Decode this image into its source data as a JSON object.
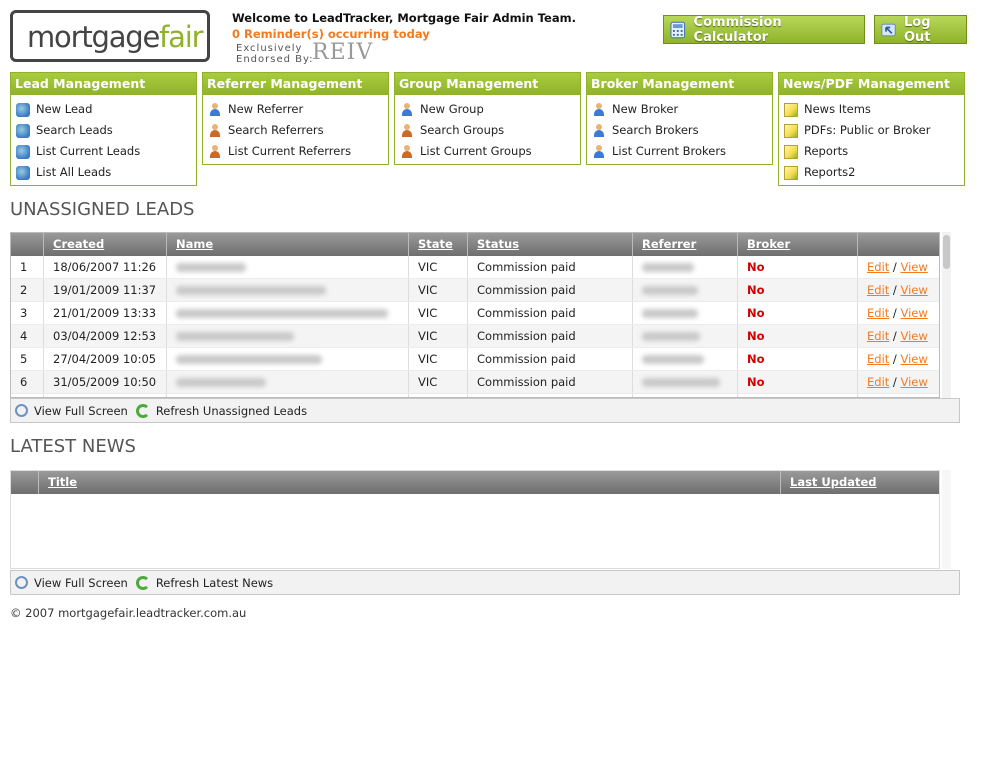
{
  "header": {
    "logo_part1": "mortgage",
    "logo_part2": "fair",
    "welcome": "Welcome to LeadTracker, Mortgage Fair Admin Team.",
    "reminder": "0 Reminder(s) occurring today",
    "endorsed_line1": "Exclusively",
    "endorsed_line2": "Endorsed By:",
    "endorser": "REIV",
    "commission_button": "Commission Calculator",
    "logout_button": "Log Out"
  },
  "menus": [
    {
      "title": "Lead Management",
      "icon": "lead-icon",
      "items": [
        "New Lead",
        "Search Leads",
        "List Current Leads",
        "List All Leads"
      ]
    },
    {
      "title": "Referrer Management",
      "icon": "user-icon",
      "items": [
        "New Referrer",
        "Search Referrers",
        "List Current Referrers"
      ]
    },
    {
      "title": "Group Management",
      "icon": "user-icon",
      "items": [
        "New Group",
        "Search Groups",
        "List Current Groups"
      ]
    },
    {
      "title": "Broker Management",
      "icon": "user-icon",
      "items": [
        "New Broker",
        "Search Brokers",
        "List Current Brokers"
      ]
    },
    {
      "title": "News/PDF Management",
      "icon": "notepad-icon",
      "items": [
        "News Items",
        "PDFs: Public or Broker",
        "Reports",
        "Reports2"
      ]
    }
  ],
  "unassigned": {
    "title": "UNASSIGNED LEADS",
    "columns": [
      "",
      "Created",
      "Name",
      "State",
      "Status",
      "Referrer",
      "Broker",
      ""
    ],
    "rows": [
      {
        "num": "1",
        "created": "18/06/2007 11:26",
        "state": "VIC",
        "status": "Commission paid",
        "broker": "No",
        "edit": "Edit",
        "view": "View"
      },
      {
        "num": "2",
        "created": "19/01/2009 11:37",
        "state": "VIC",
        "status": "Commission paid",
        "broker": "No",
        "edit": "Edit",
        "view": "View"
      },
      {
        "num": "3",
        "created": "21/01/2009 13:33",
        "state": "VIC",
        "status": "Commission paid",
        "broker": "No",
        "edit": "Edit",
        "view": "View"
      },
      {
        "num": "4",
        "created": "03/04/2009 12:53",
        "state": "VIC",
        "status": "Commission paid",
        "broker": "No",
        "edit": "Edit",
        "view": "View"
      },
      {
        "num": "5",
        "created": "27/04/2009 10:05",
        "state": "VIC",
        "status": "Commission paid",
        "broker": "No",
        "edit": "Edit",
        "view": "View"
      },
      {
        "num": "6",
        "created": "31/05/2009 10:50",
        "state": "VIC",
        "status": "Commission paid",
        "broker": "No",
        "edit": "Edit",
        "view": "View"
      }
    ],
    "view_full_screen": "View Full Screen",
    "refresh": "Refresh Unassigned Leads"
  },
  "news": {
    "title": "LATEST NEWS",
    "col_title": "Title",
    "col_updated": "Last Updated",
    "view_full_screen": "View Full Screen",
    "refresh": "Refresh Latest News"
  },
  "footer": "© 2007 mortgagefair.leadtracker.com.au"
}
